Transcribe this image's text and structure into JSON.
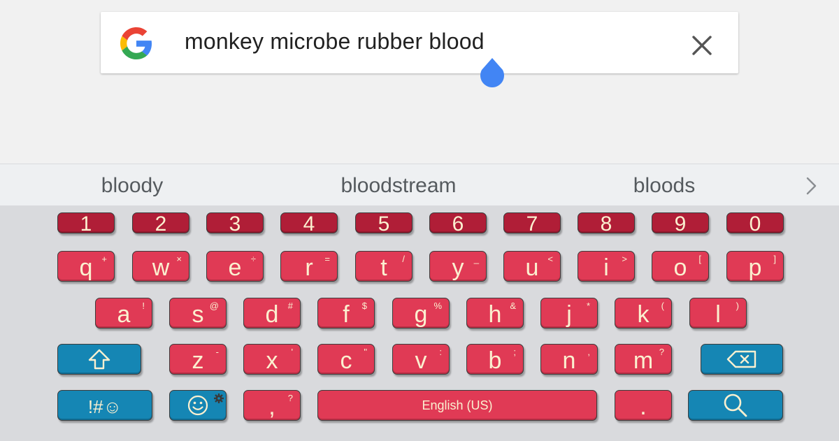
{
  "search": {
    "query": "monkey microbe rubber blood"
  },
  "suggestions": {
    "items": [
      "bloody",
      "bloodstream",
      "bloods"
    ]
  },
  "keyboard": {
    "numbers": [
      "1",
      "2",
      "3",
      "4",
      "5",
      "6",
      "7",
      "8",
      "9",
      "0"
    ],
    "row1": [
      {
        "main": "q",
        "sec": "+"
      },
      {
        "main": "w",
        "sec": "×"
      },
      {
        "main": "e",
        "sec": "÷"
      },
      {
        "main": "r",
        "sec": "="
      },
      {
        "main": "t",
        "sec": "/"
      },
      {
        "main": "y",
        "sec": "_"
      },
      {
        "main": "u",
        "sec": "<"
      },
      {
        "main": "i",
        "sec": ">"
      },
      {
        "main": "o",
        "sec": "["
      },
      {
        "main": "p",
        "sec": "]"
      }
    ],
    "row2": [
      {
        "main": "a",
        "sec": "!"
      },
      {
        "main": "s",
        "sec": "@"
      },
      {
        "main": "d",
        "sec": "#"
      },
      {
        "main": "f",
        "sec": "$"
      },
      {
        "main": "g",
        "sec": "%"
      },
      {
        "main": "h",
        "sec": "&"
      },
      {
        "main": "j",
        "sec": "*"
      },
      {
        "main": "k",
        "sec": "("
      },
      {
        "main": "l",
        "sec": ")"
      }
    ],
    "row3": [
      {
        "main": "z",
        "sec": "-"
      },
      {
        "main": "x",
        "sec": "'"
      },
      {
        "main": "c",
        "sec": "\""
      },
      {
        "main": "v",
        "sec": ":"
      },
      {
        "main": "b",
        "sec": ";"
      },
      {
        "main": "n",
        "sec": ","
      },
      {
        "main": "m",
        "sec": "?"
      }
    ],
    "symbols_label": "!#☺",
    "comma": {
      "main": ",",
      "sec": "?"
    },
    "space_label": "English (US)",
    "period": "."
  },
  "colors": {
    "number_key": "#b01e37",
    "letter_key": "#e03a55",
    "function_key": "#1586b4",
    "key_text": "#fbf0d0",
    "cursor_handle": "#4285f4"
  },
  "icons": {
    "google_logo": "google-g-logo",
    "clear": "close-icon",
    "more_suggestions": "chevron-right-icon",
    "shift": "shift-arrow-icon",
    "backspace": "backspace-icon",
    "emoji": "smiley-icon",
    "settings": "gear-icon",
    "search": "search-icon"
  }
}
